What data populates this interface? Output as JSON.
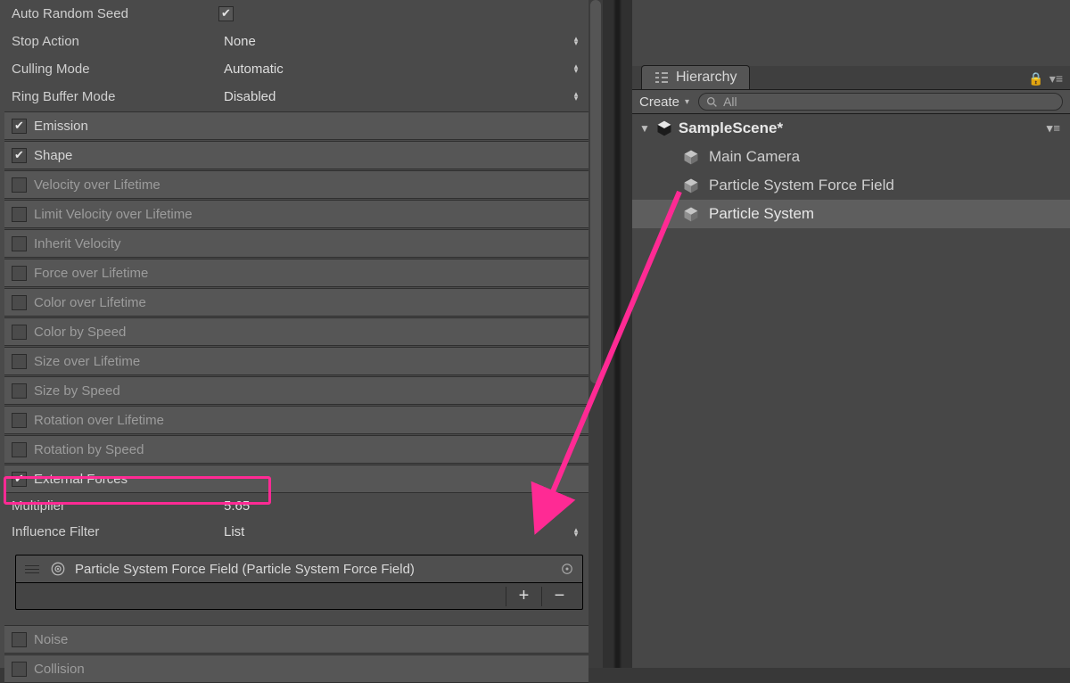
{
  "inspector": {
    "props": {
      "autoRandomSeed": {
        "label": "Auto Random Seed",
        "checked": true
      },
      "stopAction": {
        "label": "Stop Action",
        "value": "None"
      },
      "cullingMode": {
        "label": "Culling Mode",
        "value": "Automatic"
      },
      "ringBufferMode": {
        "label": "Ring Buffer Mode",
        "value": "Disabled"
      }
    },
    "modules": [
      {
        "name": "Emission",
        "enabled": true
      },
      {
        "name": "Shape",
        "enabled": true
      },
      {
        "name": "Velocity over Lifetime",
        "enabled": false
      },
      {
        "name": "Limit Velocity over Lifetime",
        "enabled": false
      },
      {
        "name": "Inherit Velocity",
        "enabled": false
      },
      {
        "name": "Force over Lifetime",
        "enabled": false
      },
      {
        "name": "Color over Lifetime",
        "enabled": false
      },
      {
        "name": "Color by Speed",
        "enabled": false
      },
      {
        "name": "Size over Lifetime",
        "enabled": false
      },
      {
        "name": "Size by Speed",
        "enabled": false
      },
      {
        "name": "Rotation over Lifetime",
        "enabled": false
      },
      {
        "name": "Rotation by Speed",
        "enabled": false
      },
      {
        "name": "External Forces",
        "enabled": true
      }
    ],
    "externalForces": {
      "multiplier": {
        "label": "Multiplier",
        "value": "5.65"
      },
      "influenceFilter": {
        "label": "Influence Filter",
        "value": "List"
      },
      "listEntry": "Particle System Force Field (Particle System Force Field)"
    },
    "tailModules": [
      {
        "name": "Noise",
        "enabled": false
      },
      {
        "name": "Collision",
        "enabled": false
      }
    ]
  },
  "hierarchy": {
    "tab": "Hierarchy",
    "createLabel": "Create",
    "searchPlaceholder": "All",
    "scene": "SampleScene*",
    "items": [
      {
        "name": "Main Camera",
        "selected": false
      },
      {
        "name": "Particle System Force Field",
        "selected": false
      },
      {
        "name": "Particle System",
        "selected": true
      }
    ]
  },
  "annotation": {
    "color": "#ff2a94"
  }
}
